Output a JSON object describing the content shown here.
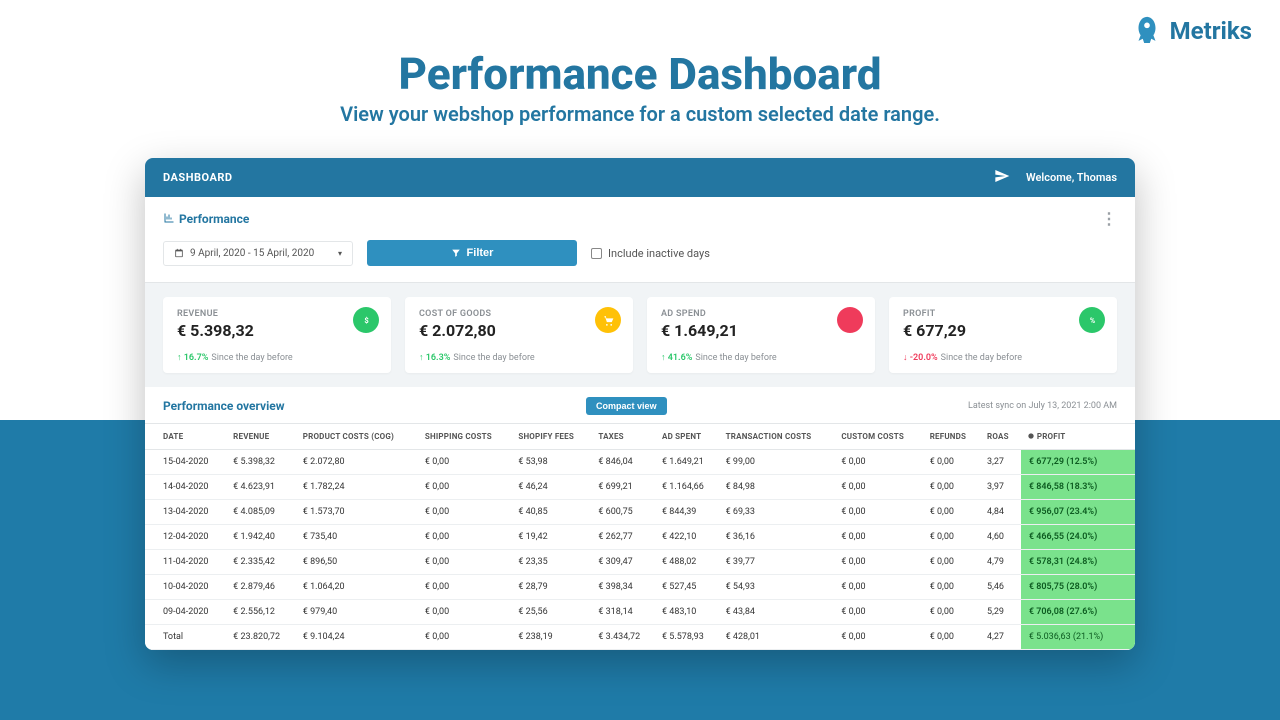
{
  "brand": {
    "name": "Metriks"
  },
  "hero": {
    "title": "Performance Dashboard",
    "subtitle": "View your webshop performance for a custom selected date range."
  },
  "topbar": {
    "title": "DASHBOARD",
    "welcome": "Welcome, Thomas"
  },
  "panel": {
    "title": "Performance",
    "date_range": "9 April, 2020 - 15 April, 2020",
    "filter_label": "Filter",
    "inactive_label": "Include inactive days"
  },
  "kpis": [
    {
      "label": "REVENUE",
      "value": "€ 5.398,32",
      "pct": "16.7%",
      "dir": "up",
      "since": "Since the day before",
      "chip": "green",
      "icon": "dollar"
    },
    {
      "label": "COST OF GOODS",
      "value": "€ 2.072,80",
      "pct": "16.3%",
      "dir": "up",
      "since": "Since the day before",
      "chip": "yellow",
      "icon": "cart"
    },
    {
      "label": "AD SPEND",
      "value": "€ 1.649,21",
      "pct": "41.6%",
      "dir": "up",
      "since": "Since the day before",
      "chip": "red",
      "icon": ""
    },
    {
      "label": "PROFIT",
      "value": "€ 677,29",
      "pct": "-20.0%",
      "dir": "down",
      "since": "Since the day before",
      "chip": "green",
      "icon": "percent"
    }
  ],
  "table": {
    "title": "Performance overview",
    "compact_label": "Compact view",
    "sync": "Latest sync on July 13, 2021 2:00 AM",
    "columns": [
      "DATE",
      "REVENUE",
      "PRODUCT COSTS (COG)",
      "SHIPPING COSTS",
      "SHOPIFY FEES",
      "TAXES",
      "AD SPENT",
      "TRANSACTION COSTS",
      "CUSTOM COSTS",
      "REFUNDS",
      "ROAS",
      "PROFIT"
    ],
    "rows": [
      {
        "c": [
          "15-04-2020",
          "€ 5.398,32",
          "€ 2.072,80",
          "€ 0,00",
          "€ 53,98",
          "€ 846,04",
          "€ 1.649,21",
          "€ 99,00",
          "€ 0,00",
          "€ 0,00",
          "3,27",
          "€ 677,29 (12.5%)"
        ]
      },
      {
        "c": [
          "14-04-2020",
          "€ 4.623,91",
          "€ 1.782,24",
          "€ 0,00",
          "€ 46,24",
          "€ 699,21",
          "€ 1.164,66",
          "€ 84,98",
          "€ 0,00",
          "€ 0,00",
          "3,97",
          "€ 846,58 (18.3%)"
        ]
      },
      {
        "c": [
          "13-04-2020",
          "€ 4.085,09",
          "€ 1.573,70",
          "€ 0,00",
          "€ 40,85",
          "€ 600,75",
          "€ 844,39",
          "€ 69,33",
          "€ 0,00",
          "€ 0,00",
          "4,84",
          "€ 956,07 (23.4%)"
        ]
      },
      {
        "c": [
          "12-04-2020",
          "€ 1.942,40",
          "€ 735,40",
          "€ 0,00",
          "€ 19,42",
          "€ 262,77",
          "€ 422,10",
          "€ 36,16",
          "€ 0,00",
          "€ 0,00",
          "4,60",
          "€ 466,55 (24.0%)"
        ]
      },
      {
        "c": [
          "11-04-2020",
          "€ 2.335,42",
          "€ 896,50",
          "€ 0,00",
          "€ 23,35",
          "€ 309,47",
          "€ 488,02",
          "€ 39,77",
          "€ 0,00",
          "€ 0,00",
          "4,79",
          "€ 578,31 (24.8%)"
        ]
      },
      {
        "c": [
          "10-04-2020",
          "€ 2.879,46",
          "€ 1.064,20",
          "€ 0,00",
          "€ 28,79",
          "€ 398,34",
          "€ 527,45",
          "€ 54,93",
          "€ 0,00",
          "€ 0,00",
          "5,46",
          "€ 805,75 (28.0%)"
        ]
      },
      {
        "c": [
          "09-04-2020",
          "€ 2.556,12",
          "€ 979,40",
          "€ 0,00",
          "€ 25,56",
          "€ 318,14",
          "€ 483,10",
          "€ 43,84",
          "€ 0,00",
          "€ 0,00",
          "5,29",
          "€ 706,08 (27.6%)"
        ]
      }
    ],
    "total": {
      "c": [
        "Total",
        "€ 23.820,72",
        "€ 9.104,24",
        "€ 0,00",
        "€ 238,19",
        "€ 3.434,72",
        "€ 5.578,93",
        "€ 428,01",
        "€ 0,00",
        "€ 0,00",
        "4,27",
        "€ 5.036,63 (21.1%)"
      ]
    }
  }
}
